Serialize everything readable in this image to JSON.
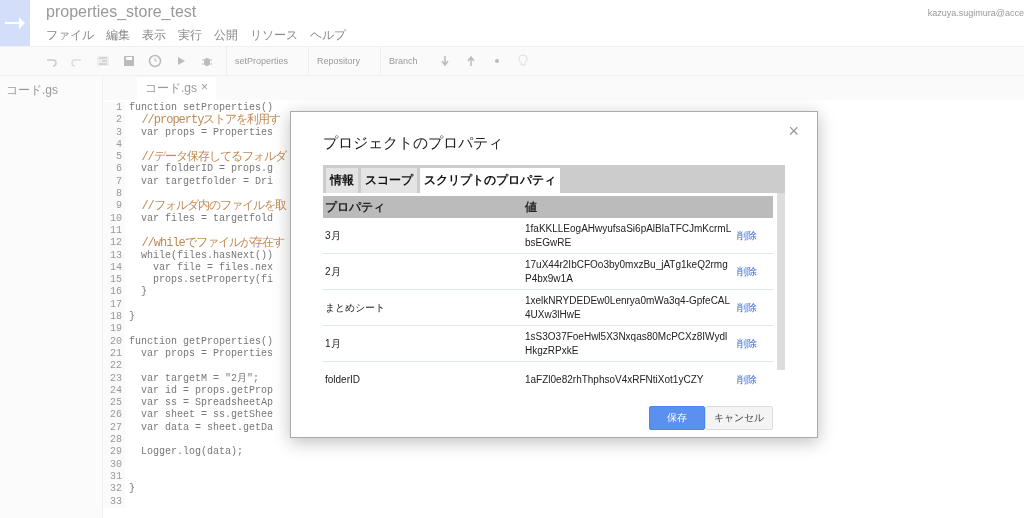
{
  "header": {
    "title": "properties_store_test",
    "user": "kazuya.sugimura@acce",
    "menu": [
      "ファイル",
      "編集",
      "表示",
      "実行",
      "公開",
      "リソース",
      "ヘルプ"
    ]
  },
  "toolbar": {
    "function_select": "setProperties",
    "repository": "Repository",
    "branch": "Branch"
  },
  "sidebar": {
    "file": "コード.gs"
  },
  "editor": {
    "tab": "コード.gs",
    "tab_close": "×",
    "lines": [
      {
        "number": "1",
        "kind": "code",
        "text": "function setProperties()"
      },
      {
        "number": "2",
        "kind": "comment",
        "text": "  //propertyストアを利用す"
      },
      {
        "number": "3",
        "kind": "code",
        "text": "  var props = Properties"
      },
      {
        "number": "4"
      },
      {
        "number": "5",
        "kind": "comment",
        "text": "  //データ保存してるフォルダ"
      },
      {
        "number": "6",
        "kind": "code",
        "text": "  var folderID = props.g"
      },
      {
        "number": "7",
        "kind": "code",
        "text": "  var targetfolder = Dri"
      },
      {
        "number": "8"
      },
      {
        "number": "9",
        "kind": "comment",
        "text": "  //フォルダ内のファイルを取"
      },
      {
        "number": "10",
        "kind": "code",
        "text": "  var files = targetfold"
      },
      {
        "number": "11"
      },
      {
        "number": "12",
        "kind": "comment",
        "text": "  //whileでファイルが存在す"
      },
      {
        "number": "13",
        "kind": "code",
        "text": "  while(files.hasNext())"
      },
      {
        "number": "14",
        "kind": "code",
        "text": "    var file = files.nex"
      },
      {
        "number": "15",
        "kind": "code",
        "text": "    props.setProperty(fi"
      },
      {
        "number": "16",
        "kind": "code",
        "text": "  }"
      },
      {
        "number": "17"
      },
      {
        "number": "18",
        "kind": "code",
        "text": "}"
      },
      {
        "number": "19"
      },
      {
        "number": "20",
        "kind": "code",
        "text": "function getProperties()"
      },
      {
        "number": "21",
        "kind": "code",
        "text": "  var props = Properties"
      },
      {
        "number": "22"
      },
      {
        "number": "23",
        "kind": "code",
        "text": "  var targetM = \"2月\";"
      },
      {
        "number": "24",
        "kind": "code",
        "text": "  var id = props.getProp"
      },
      {
        "number": "25",
        "kind": "code",
        "text": "  var ss = SpreadsheetAp"
      },
      {
        "number": "26",
        "kind": "code",
        "text": "  var sheet = ss.getShee"
      },
      {
        "number": "27",
        "kind": "code",
        "text": "  var data = sheet.getDa"
      },
      {
        "number": "28"
      },
      {
        "number": "29",
        "kind": "code",
        "text": "  Logger.log(data);"
      },
      {
        "number": "30"
      },
      {
        "number": "31"
      },
      {
        "number": "32",
        "kind": "code",
        "text": "}"
      },
      {
        "number": "33"
      }
    ]
  },
  "dialog": {
    "title": "プロジェクトのプロパティ",
    "close": "×",
    "tabs": [
      {
        "label": "情報",
        "selected": false
      },
      {
        "label": "スコープ",
        "selected": false
      },
      {
        "label": "スクリプトのプロパティ",
        "selected": true
      }
    ],
    "table": {
      "columns": [
        "プロパティ",
        "値"
      ],
      "rows": [
        {
          "property": "3月",
          "value": "1faKKLLEogAHwyufsaSi6pAlBlaTFCJmKcrmLbsEGwRE",
          "action": "削除"
        },
        {
          "property": "2月",
          "value": "17uX44r2IbCFOo3by0mxzBu_jATg1keQ2rmgP4bx9w1A",
          "action": "削除"
        },
        {
          "property": "まとめシート",
          "value": "1xelkNRYDEDEw0Lenrya0mWa3q4-GpfeCAL4UXw3lHwE",
          "action": "削除"
        },
        {
          "property": "1月",
          "value": "1sS3O37FoeHwl5X3Nxqas80McPCXz8IWydlHkgzRPxkE",
          "action": "削除"
        },
        {
          "property": "folderID",
          "value": "1aFZl0e82rhThphsoV4xRFNtiXot1yCZY",
          "action": "削除"
        }
      ]
    },
    "buttons": [
      {
        "label": "保存",
        "kind": "primary"
      },
      {
        "label": "キャンセル",
        "kind": "secondary"
      }
    ]
  }
}
